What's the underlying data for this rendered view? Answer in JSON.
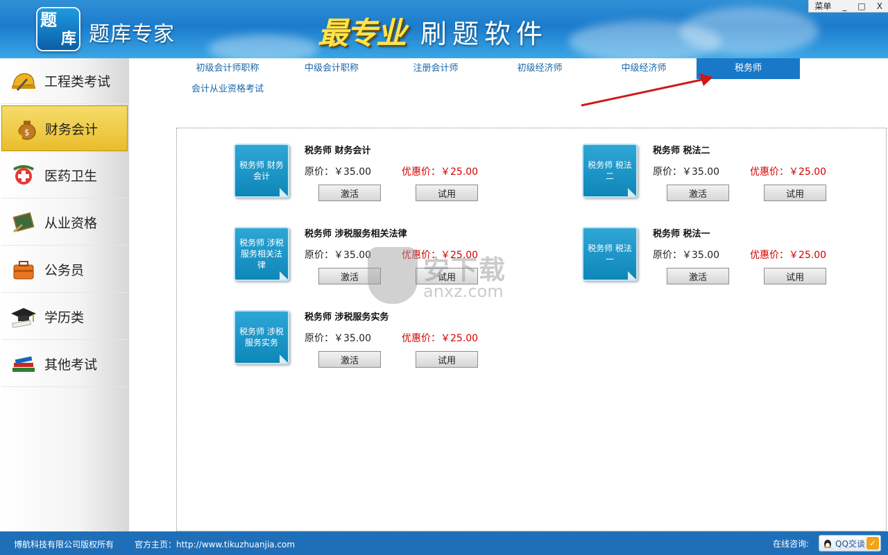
{
  "header": {
    "logo_line1": "题",
    "logo_line2": "库",
    "app_title": "题库专家",
    "brand_stylized": "最专业",
    "brand_sub": "刷题软件",
    "window_controls": {
      "menu": "菜单",
      "minimize": "_",
      "maximize": "□",
      "close": "X"
    }
  },
  "sidebar": {
    "items": [
      {
        "label": "工程类考试",
        "icon": "hardhat-icon"
      },
      {
        "label": "财务会计",
        "icon": "money-bag-icon",
        "active": true
      },
      {
        "label": "医药卫生",
        "icon": "medical-icon"
      },
      {
        "label": "从业资格",
        "icon": "certificate-icon"
      },
      {
        "label": "公务员",
        "icon": "briefcase-icon"
      },
      {
        "label": "学历类",
        "icon": "graduation-cap-icon"
      },
      {
        "label": "其他考试",
        "icon": "books-icon"
      }
    ]
  },
  "tabs": [
    {
      "label": "初级会计师职称"
    },
    {
      "label": "中级会计职称"
    },
    {
      "label": "注册会计师"
    },
    {
      "label": "初级经济师"
    },
    {
      "label": "中级经济师"
    },
    {
      "label": "税务师",
      "active": true
    },
    {
      "label": "会计从业资格考试"
    }
  ],
  "products": [
    {
      "icon_text": "税务师 财务会计",
      "title": "税务师 财务会计",
      "original": "原价：￥35.00",
      "sale": "优惠价：￥25.00",
      "activate": "激活",
      "trial": "试用"
    },
    {
      "icon_text": "税务师 税法二",
      "title": "税务师 税法二",
      "original": "原价：￥35.00",
      "sale": "优惠价：￥25.00",
      "activate": "激活",
      "trial": "试用"
    },
    {
      "icon_text": "税务师 涉税服务相关法律",
      "title": "税务师 涉税服务相关法律",
      "original": "原价：￥35.00",
      "sale": "优惠价：￥25.00",
      "activate": "激活",
      "trial": "试用"
    },
    {
      "icon_text": "税务师 税法一",
      "title": "税务师 税法一",
      "original": "原价：￥35.00",
      "sale": "优惠价：￥25.00",
      "activate": "激活",
      "trial": "试用"
    },
    {
      "icon_text": "税务师 涉税服务实务",
      "title": "税务师 涉税服务实务",
      "original": "原价：￥35.00",
      "sale": "优惠价：￥25.00",
      "activate": "激活",
      "trial": "试用"
    }
  ],
  "watermark": {
    "text": "安下载",
    "sub": "anxz.com"
  },
  "footer": {
    "copyright": "博航科技有限公司版权所有",
    "website": "官方主页：http://www.tikuzhuanjia.com",
    "consult_label": "在线咨询:",
    "qq_label": "QQ交谈"
  },
  "colors": {
    "header_blue": "#1c7ccc",
    "active_tab": "#1a78c8",
    "sale_red": "#d40000",
    "sidebar_active": "#e9bd2b",
    "footer_blue": "#1f6fb8"
  }
}
